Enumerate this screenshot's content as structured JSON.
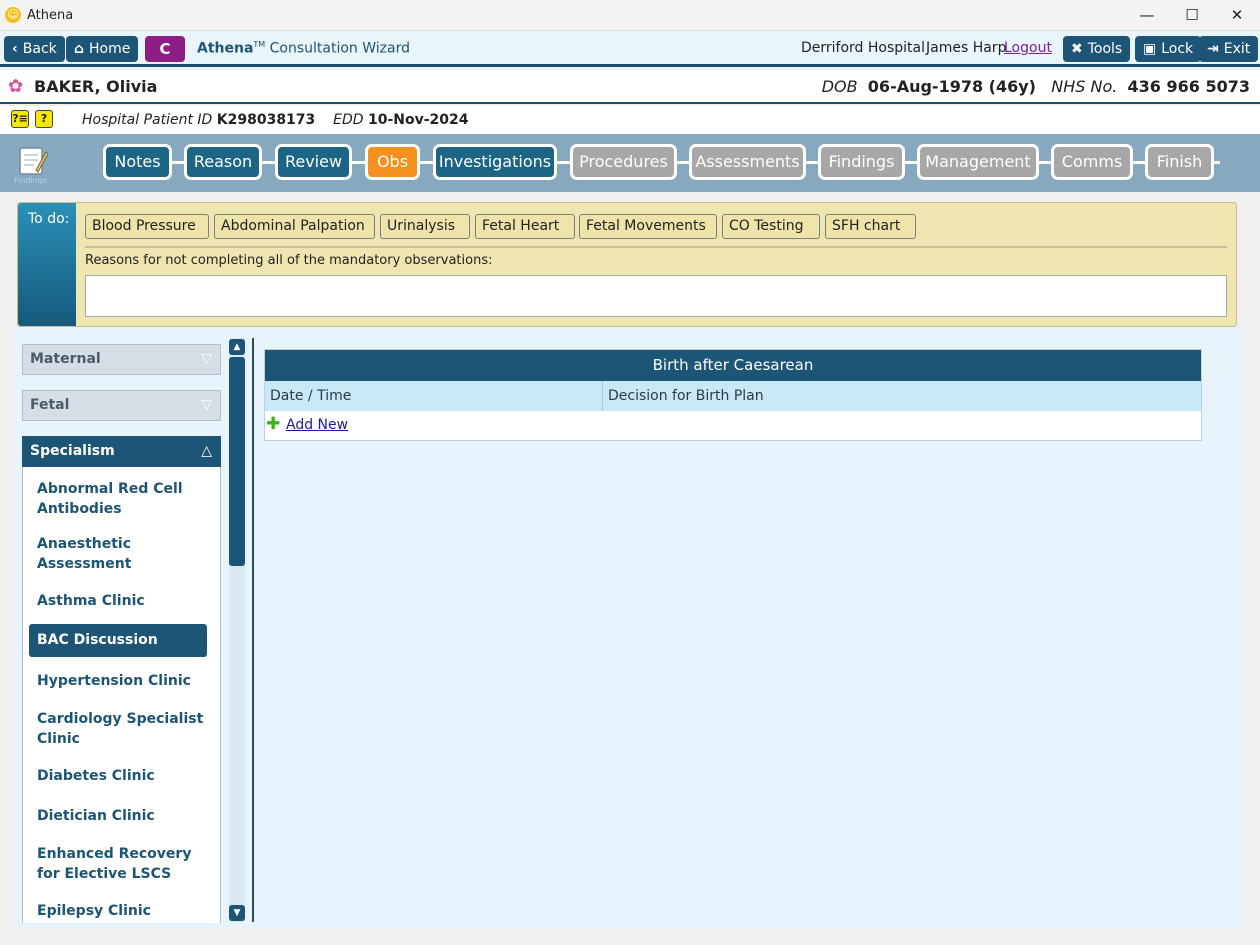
{
  "window": {
    "title": "Athena",
    "minimize": "—",
    "maximize": "☐",
    "close": "✕"
  },
  "nav": {
    "back": "Back",
    "home": "Home",
    "c_button": "C",
    "wizard_brand": "Athena",
    "wizard_tm": "TM",
    "wizard_title": " Consultation Wizard",
    "hospital": "Derriford Hospital",
    "user": "James Harp",
    "logout": "Logout",
    "tools": "Tools",
    "lock": "Lock",
    "exit": "Exit"
  },
  "patient": {
    "name": "BAKER, Olivia",
    "dob_label": "DOB",
    "dob": "06-Aug-1978 (46y)",
    "nhs_label": "NHS No.",
    "nhs": "436 966 5073",
    "hpid_label": "Hospital Patient ID",
    "hpid": "K298038173",
    "edd_label": "EDD",
    "edd": "10-Nov-2024"
  },
  "steps": {
    "icon_label": "Findings",
    "items": [
      {
        "label": "Notes",
        "state": "done"
      },
      {
        "label": "Reason",
        "state": "done"
      },
      {
        "label": "Review",
        "state": "done"
      },
      {
        "label": "Obs",
        "state": "active"
      },
      {
        "label": "Investigations",
        "state": "done"
      },
      {
        "label": "Procedures",
        "state": "todo"
      },
      {
        "label": "Assessments",
        "state": "todo"
      },
      {
        "label": "Findings",
        "state": "todo"
      },
      {
        "label": "Management",
        "state": "todo"
      },
      {
        "label": "Comms",
        "state": "todo"
      },
      {
        "label": "Finish",
        "state": "todo"
      }
    ]
  },
  "todo": {
    "label": "To do:",
    "items": [
      "Blood Pressure",
      "Abdominal Palpation",
      "Urinalysis",
      "Fetal Heart",
      "Fetal Movements",
      "CO Testing",
      "SFH chart"
    ],
    "reason_label": "Reasons for not completing all of the mandatory observations:",
    "reason_value": ""
  },
  "sidebar": {
    "sections": [
      {
        "label": "Maternal",
        "expanded": false
      },
      {
        "label": "Fetal",
        "expanded": false
      },
      {
        "label": "Specialism",
        "expanded": true
      }
    ],
    "items": [
      {
        "label": "Abnormal Red Cell Antibodies"
      },
      {
        "label": "Anaesthetic Assessment"
      },
      {
        "label": "Asthma Clinic"
      },
      {
        "label": "BAC Discussion",
        "selected": true
      },
      {
        "label": "Hypertension Clinic"
      },
      {
        "label": "Cardiology Specialist Clinic"
      },
      {
        "label": "Diabetes Clinic"
      },
      {
        "label": "Dietician Clinic"
      },
      {
        "label": "Enhanced Recovery for Elective LSCS"
      },
      {
        "label": "Epilepsy Clinic"
      }
    ]
  },
  "table": {
    "title": "Birth after Caesarean",
    "columns": [
      "Date / Time",
      "Decision for Birth Plan"
    ],
    "add_new": "Add New"
  },
  "colors": {
    "primary": "#1c5575",
    "active_step": "#f39020",
    "inactive_step": "#a7a7a7",
    "todo_bg": "#efe5b0",
    "logout": "#7a1fa2"
  }
}
